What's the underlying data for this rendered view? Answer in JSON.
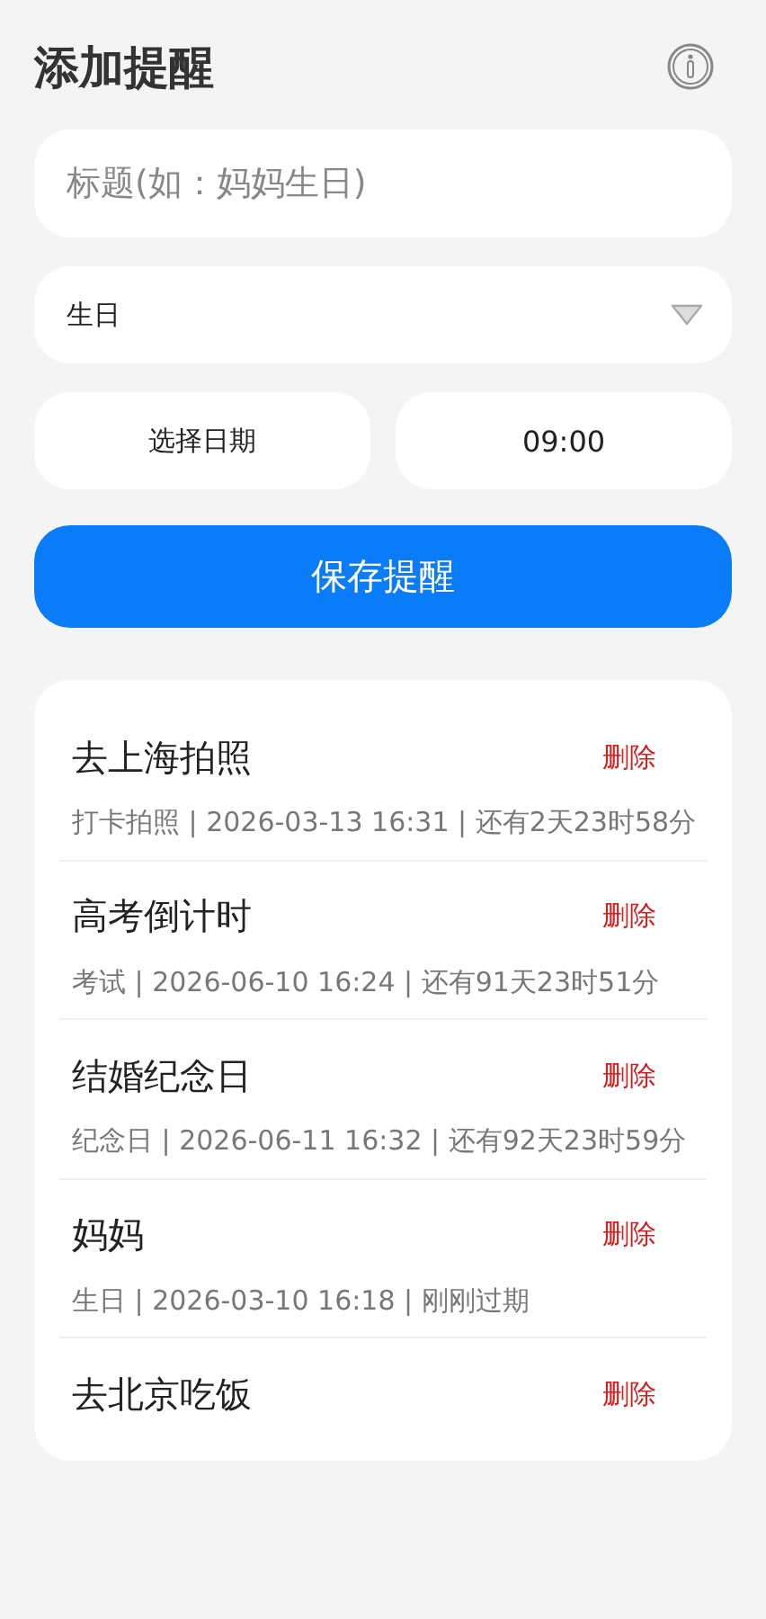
{
  "header": {
    "title": "添加提醒"
  },
  "form": {
    "title_field": {
      "placeholder": "标题(如：妈妈生日)"
    },
    "category": {
      "value": "生日"
    },
    "date_button": "选择日期",
    "time_button": "09:00",
    "save_button": "保存提醒"
  },
  "reminders": [
    {
      "title": "去上海拍照",
      "meta": "打卡拍照 | 2026-03-13 16:31 | 还有2天23时58分",
      "delete": "删除"
    },
    {
      "title": "高考倒计时",
      "meta": "考试 | 2026-06-10 16:24 | 还有91天23时51分",
      "delete": "删除"
    },
    {
      "title": "结婚纪念日",
      "meta": "纪念日 | 2026-06-11 16:32 | 还有92天23时59分",
      "delete": "删除"
    },
    {
      "title": "妈妈",
      "meta": "生日 | 2026-03-10 16:18 | 刚刚过期",
      "delete": "删除"
    },
    {
      "title": "去北京吃饭",
      "delete": "删除"
    }
  ]
}
